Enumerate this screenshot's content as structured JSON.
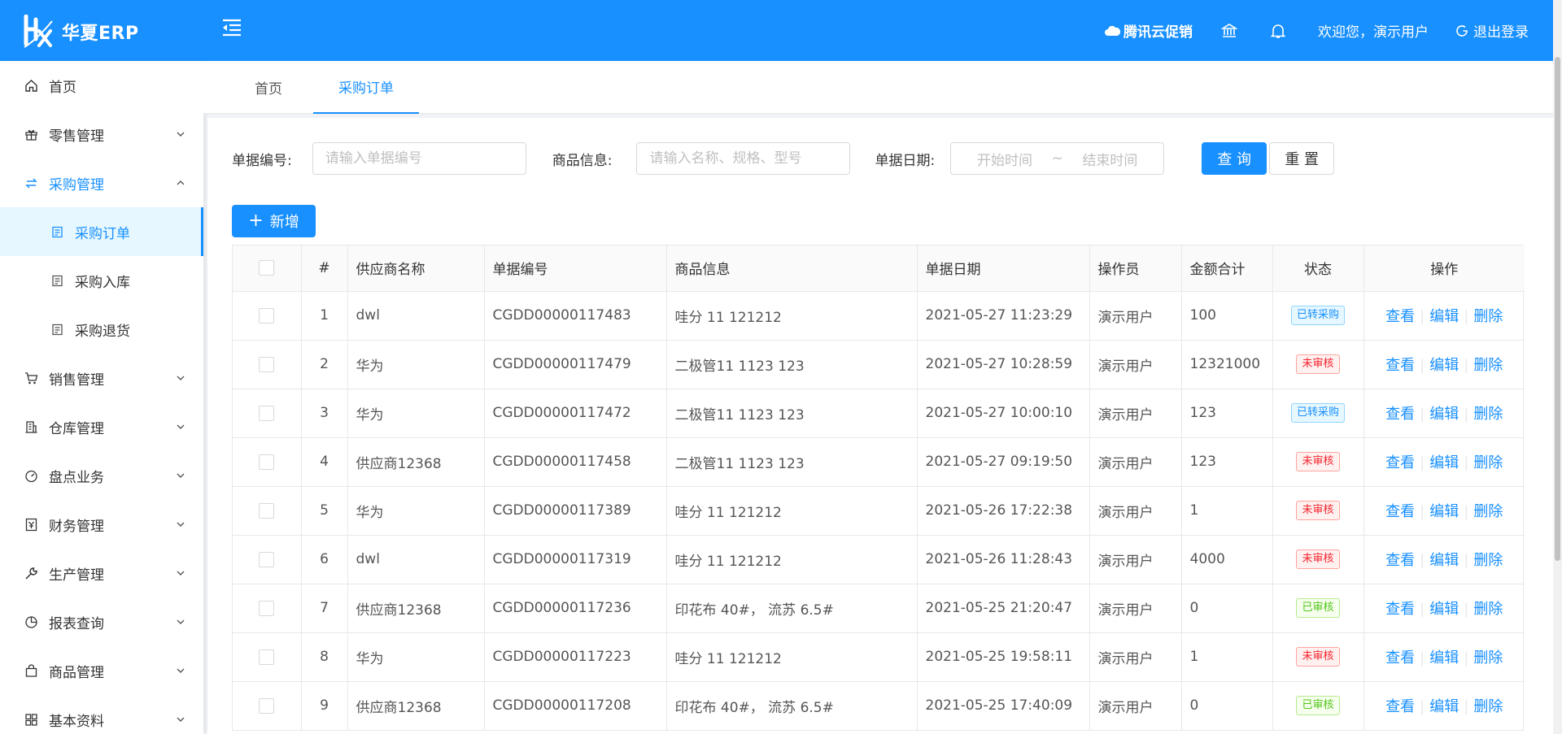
{
  "app": {
    "title": "华夏ERP"
  },
  "header": {
    "promo": "腾讯云促销",
    "welcome": "欢迎您，演示用户",
    "logout": "退出登录"
  },
  "sidebar": {
    "items": [
      {
        "label": "首页",
        "icon": "home-icon"
      },
      {
        "label": "零售管理",
        "icon": "gift-icon"
      },
      {
        "label": "采购管理",
        "icon": "swap-icon"
      },
      {
        "label": "采购订单",
        "icon": "doc-icon"
      },
      {
        "label": "采购入库",
        "icon": "doc-icon"
      },
      {
        "label": "采购退货",
        "icon": "doc-icon"
      },
      {
        "label": "销售管理",
        "icon": "cart-icon"
      },
      {
        "label": "仓库管理",
        "icon": "building-icon"
      },
      {
        "label": "盘点业务",
        "icon": "dashboard-icon"
      },
      {
        "label": "财务管理",
        "icon": "finance-icon"
      },
      {
        "label": "生产管理",
        "icon": "tool-icon"
      },
      {
        "label": "报表查询",
        "icon": "pie-icon"
      },
      {
        "label": "商品管理",
        "icon": "bag-icon"
      },
      {
        "label": "基本资料",
        "icon": "grid-icon"
      }
    ]
  },
  "tabs": [
    {
      "label": "首页"
    },
    {
      "label": "采购订单"
    }
  ],
  "filters": {
    "bill_no_label": "单据编号:",
    "bill_no_placeholder": "请输入单据编号",
    "goods_label": "商品信息:",
    "goods_placeholder": "请输入名称、规格、型号",
    "date_label": "单据日期:",
    "date_start": "开始时间",
    "date_sep": "~",
    "date_end": "结束时间",
    "query": "查 询",
    "reset": "重 置"
  },
  "add_button": "新增",
  "table": {
    "columns": [
      "#",
      "供应商名称",
      "单据编号",
      "商品信息",
      "单据日期",
      "操作员",
      "金额合计",
      "状态",
      "操作"
    ],
    "ops": [
      "查看",
      "编辑",
      "删除"
    ],
    "rows": [
      {
        "no": "1",
        "supplier": "dwl",
        "bill": "CGDD00000117483",
        "goods": "哇分 11 121212",
        "date": "2021-05-27 11:23:29",
        "operator": "演示用户",
        "amount": "100",
        "status": "已转采购",
        "status_color": "blue"
      },
      {
        "no": "2",
        "supplier": "华为",
        "bill": "CGDD00000117479",
        "goods": "二极管11 1123 123",
        "date": "2021-05-27 10:28:59",
        "operator": "演示用户",
        "amount": "12321000",
        "status": "未审核",
        "status_color": "red"
      },
      {
        "no": "3",
        "supplier": "华为",
        "bill": "CGDD00000117472",
        "goods": "二极管11 1123 123",
        "date": "2021-05-27 10:00:10",
        "operator": "演示用户",
        "amount": "123",
        "status": "已转采购",
        "status_color": "blue"
      },
      {
        "no": "4",
        "supplier": "供应商12368",
        "bill": "CGDD00000117458",
        "goods": "二极管11 1123 123",
        "date": "2021-05-27 09:19:50",
        "operator": "演示用户",
        "amount": "123",
        "status": "未审核",
        "status_color": "red"
      },
      {
        "no": "5",
        "supplier": "华为",
        "bill": "CGDD00000117389",
        "goods": "哇分 11 121212",
        "date": "2021-05-26 17:22:38",
        "operator": "演示用户",
        "amount": "1",
        "status": "未审核",
        "status_color": "red"
      },
      {
        "no": "6",
        "supplier": "dwl",
        "bill": "CGDD00000117319",
        "goods": "哇分 11 121212",
        "date": "2021-05-26 11:28:43",
        "operator": "演示用户",
        "amount": "4000",
        "status": "未审核",
        "status_color": "red"
      },
      {
        "no": "7",
        "supplier": "供应商12368",
        "bill": "CGDD00000117236",
        "goods": "印花布 40#， 流苏 6.5#",
        "date": "2021-05-25 21:20:47",
        "operator": "演示用户",
        "amount": "0",
        "status": "已审核",
        "status_color": "green"
      },
      {
        "no": "8",
        "supplier": "华为",
        "bill": "CGDD00000117223",
        "goods": "哇分 11 121212",
        "date": "2021-05-25 19:58:11",
        "operator": "演示用户",
        "amount": "1",
        "status": "未审核",
        "status_color": "red"
      },
      {
        "no": "9",
        "supplier": "供应商12368",
        "bill": "CGDD00000117208",
        "goods": "印花布 40#， 流苏 6.5#",
        "date": "2021-05-25 17:40:09",
        "operator": "演示用户",
        "amount": "0",
        "status": "已审核",
        "status_color": "green"
      }
    ]
  }
}
